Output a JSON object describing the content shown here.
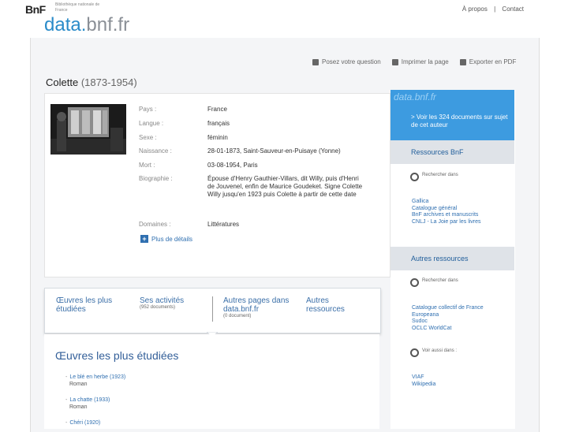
{
  "header": {
    "bnf_logo": "BnF",
    "bnf_tagline": "Bibliothèque nationale de France",
    "brand_prefix": "data.",
    "brand_suffix": "bnf.fr",
    "links": [
      "À propos",
      "|",
      "Contact"
    ]
  },
  "toolbar": {
    "items": [
      "Posez votre question",
      "Imprimer la page",
      "Exporter en PDF"
    ]
  },
  "author": {
    "name": "Colette",
    "dates": "(1873-1954)"
  },
  "info_rows": [
    {
      "label": "Pays :",
      "value": "France"
    },
    {
      "label": "Langue :",
      "value": "français"
    },
    {
      "label": "Sexe :",
      "value": "féminin"
    },
    {
      "label": "Naissance :",
      "value": "28-01-1873, Saint-Sauveur-en-Puisaye (Yonne)"
    },
    {
      "label": "Mort :",
      "value": "03-08-1954, Paris"
    },
    {
      "label": "Biographie :",
      "value": "Épouse d'Henry Gauthier-Villars, dit Willy, puis d'Henri de Jouvenel, enfin de Maurice Goudeket. Signe Colette Willy jusqu'en 1923 puis Colette à partir de cette date"
    },
    {
      "label": "Domaines :",
      "value": "Littératures"
    }
  ],
  "more_label": "Plus de détails",
  "sidebar": {
    "logo": "data.bnf.fr",
    "docs_link": "> Voir les 324 documents sur sujet de cet auteur",
    "resources_head": "Ressources BnF",
    "search_in": "Rechercher dans",
    "resources_links": [
      "Gallica",
      "Catalogue général",
      "BnF archives et manuscrits",
      "CNLJ - La Joie par les livres"
    ],
    "other_head": "Autres ressources",
    "search_in_2": "Rechercher dans",
    "other_links": [
      "Catalogue collectif de France",
      "Europeana",
      "Sudoc",
      "OCLC WorldCat"
    ],
    "see_also": "Voir aussi dans :",
    "see_links": [
      "VIAF",
      "Wikipedia"
    ]
  },
  "tabs": [
    {
      "label": "Œuvres les plus étudiées",
      "sub": ""
    },
    {
      "label": "Ses activités",
      "sub": "(952 documents)"
    },
    {
      "label": "Autres pages dans data.bnf.fr",
      "sub": "(0 document)"
    },
    {
      "label": "Autres ressources",
      "sub": ""
    }
  ],
  "works_section": {
    "title": "Œuvres les plus étudiées",
    "items": [
      {
        "title": "Le blé en herbe (1923)",
        "type": "Roman"
      },
      {
        "title": "La chatte (1933)",
        "type": "Roman"
      },
      {
        "title": "Chéri (1920)",
        "type": ""
      }
    ]
  }
}
